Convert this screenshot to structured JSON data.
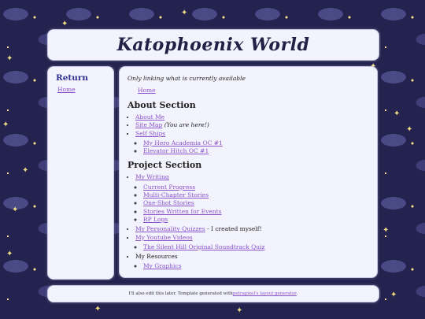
{
  "header": {
    "title": "Katophoenix World"
  },
  "sidebar": {
    "heading": "Return",
    "home_link": "Home"
  },
  "main": {
    "note": "Only linking what is currently available",
    "home_link": "Home",
    "about": {
      "heading": "About Section",
      "about_me": "About Me",
      "site_map": "Site Map",
      "site_map_suffix": "(You are here!)",
      "self_ships": "Self Ships",
      "self_ship_items": [
        "My Hero Academia OC #1",
        "Elevator Hitch OC #1"
      ]
    },
    "project": {
      "heading": "Project Section",
      "my_writing": "My Writing",
      "writing_items": [
        "Current Progress",
        "Multi-Chapter Stories",
        "One-Shot Stories",
        "Stories Written for Events",
        "RP Logs"
      ],
      "personality_quizzes": "My Personality Quizzes",
      "personality_suffix": " - I created myself!",
      "youtube_videos": "My Youtube Videos",
      "youtube_items": [
        "The Silent Hill Original Soundtrack Quiz"
      ],
      "resources": "My Resources",
      "resource_items": [
        "My Graphics"
      ]
    }
  },
  "footer": {
    "text_before": "I'll also edit this later. Template generated with ",
    "link": "petrapixel's layout generator",
    "text_after": "."
  },
  "colors": {
    "background": "#24234f",
    "panel": "#f3f3fd",
    "link": "#8b52c9",
    "heading_accent": "#2f3192"
  }
}
